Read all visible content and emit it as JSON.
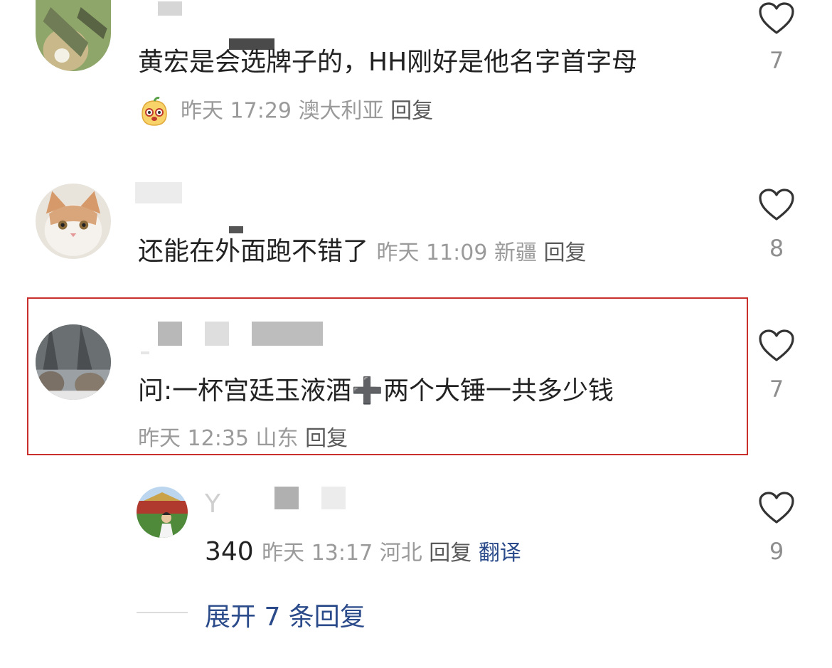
{
  "comments": [
    {
      "text": "黄宏是会选牌子的，HH刚好是他名字首字母",
      "time": "昨天 17:29",
      "location": "澳大利亚",
      "reply": "回复",
      "likes": "7"
    },
    {
      "text": "还能在外面跑不错了",
      "time": "昨天 11:09",
      "location": "新疆",
      "reply": "回复",
      "likes": "8"
    },
    {
      "text_a": "问:一杯宫廷玉液酒",
      "plus": "➕",
      "text_b": "两个大锤一共多少钱",
      "time": "昨天 12:35",
      "location": "山东",
      "reply": "回复",
      "likes": "7"
    }
  ],
  "sub_reply": {
    "name_initial": "Y",
    "text": "340",
    "time": "昨天 13:17",
    "location": "河北",
    "reply": "回复",
    "translate": "翻译",
    "likes": "9"
  },
  "expand": {
    "label": "展开 7 条回复"
  },
  "colors": {
    "highlight_border": "#c9302c",
    "link_blue": "#2a4a8a",
    "meta_gray": "#9a9a9a"
  },
  "icons": [
    "heart-outline-icon",
    "mascot-emoji-icon"
  ]
}
